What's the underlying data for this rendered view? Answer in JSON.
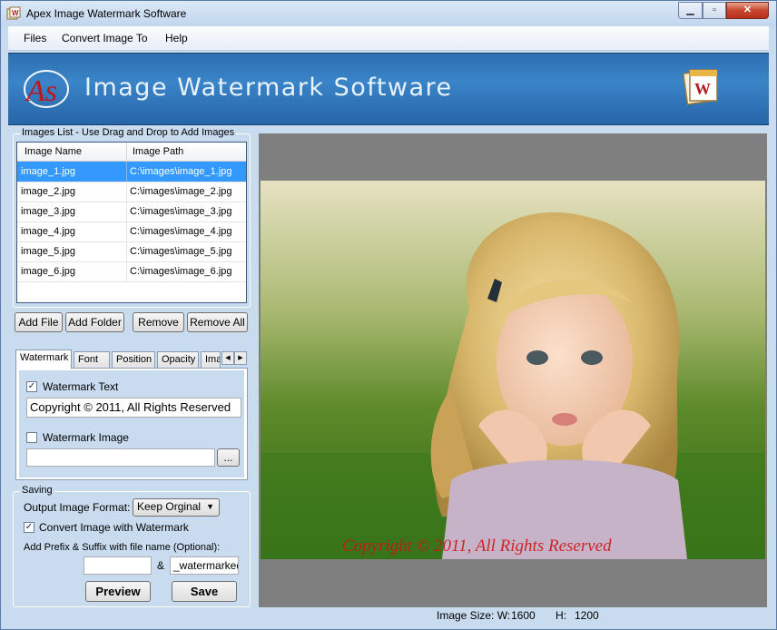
{
  "window": {
    "title": "Apex Image Watermark Software",
    "close_glyph": "✕",
    "min_glyph": "▁",
    "max_glyph": "▫"
  },
  "menu": {
    "items": [
      "Files",
      "Convert Image To",
      "Help"
    ]
  },
  "banner": {
    "title": "Image Watermark Software",
    "logo_text": "As"
  },
  "images_list": {
    "legend": "Images List - Use Drag and Drop to Add Images",
    "columns": [
      "Image Name",
      "Image Path"
    ],
    "rows": [
      {
        "name": "image_1.jpg",
        "path": "C:\\images\\image_1.jpg"
      },
      {
        "name": "image_2.jpg",
        "path": "C:\\images\\image_2.jpg"
      },
      {
        "name": "image_3.jpg",
        "path": "C:\\images\\image_3.jpg"
      },
      {
        "name": "image_4.jpg",
        "path": "C:\\images\\image_4.jpg"
      },
      {
        "name": "image_5.jpg",
        "path": "C:\\images\\image_5.jpg"
      },
      {
        "name": "image_6.jpg",
        "path": "C:\\images\\image_6.jpg"
      }
    ],
    "selected_index": 0
  },
  "list_buttons": {
    "add_file": "Add File",
    "add_folder": "Add Folder",
    "remove": "Remove",
    "remove_all": "Remove All"
  },
  "tabs": {
    "items": [
      "Watermark",
      "Font",
      "Position",
      "Opacity",
      "Ima"
    ],
    "active": "Watermark",
    "scroll_left": "◀",
    "scroll_right": "▶"
  },
  "watermark": {
    "text_label": "Watermark Text",
    "text_checked": true,
    "text_value": "Copyright © 2011, All Rights Reserved",
    "image_label": "Watermark Image",
    "image_checked": false,
    "image_path": "",
    "browse_label": "..."
  },
  "saving": {
    "legend": "Saving",
    "format_label": "Output Image Format:",
    "format_value": "Keep Orginal",
    "convert_label": "Convert Image with Watermark",
    "convert_checked": true,
    "prefix_label": "Add Prefix & Suffix with file name (Optional):",
    "prefix_value": "",
    "amp": "&",
    "suffix_value": "_watermarked",
    "preview_button": "Preview",
    "save_button": "Save"
  },
  "preview": {
    "watermark_overlay": "Copyright © 2011, All Rights Reserved"
  },
  "status": {
    "size_label": "Image Size:  W:",
    "width": "1600",
    "height_label": "H:",
    "height": "1200"
  },
  "colors": {
    "window_bg": "#c9dbee",
    "banner": "#2d6fb2",
    "selection": "#3399ff",
    "watermark_red": "#cd1414"
  }
}
